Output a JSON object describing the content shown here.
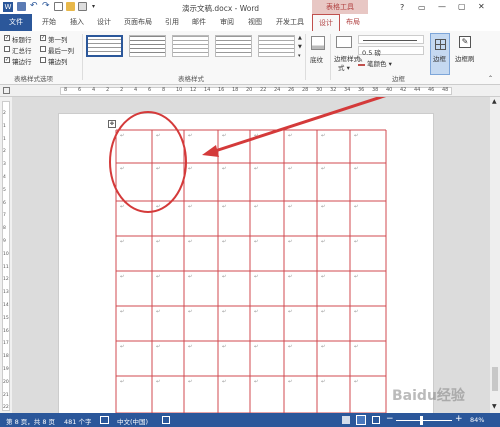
{
  "title": "演示文稿.docx - Word",
  "contextual": {
    "group": "表格工具",
    "design": "设计",
    "layout": "布局"
  },
  "tabs": [
    "开始",
    "插入",
    "设计",
    "页面布局",
    "引用",
    "邮件",
    "审阅",
    "视图",
    "开发工具"
  ],
  "file_tab": "文件",
  "window_buttons": [
    "?",
    "▭",
    "—",
    "▢",
    "✕"
  ],
  "options": {
    "header_row": "标题行",
    "first_col": "第一列",
    "total_row": "汇总行",
    "last_col": "最后一列",
    "banded_rows": "镶边行",
    "banded_cols": "镶边列",
    "group_label": "表格样式选项"
  },
  "styles_group_label": "表格样式",
  "shading": "底纹",
  "border_styles": "边框样式",
  "border_styles_sub": "式 ▾",
  "line_width": "0.5 磅",
  "pen_color": "笔颜色 ▾",
  "borders_btn": "边框",
  "border_painter": "边框刷",
  "borders_group": "边框",
  "ruler_ticks": [
    "8",
    "6",
    "4",
    "2",
    "2",
    "4",
    "6",
    "8",
    "10",
    "12",
    "14",
    "16",
    "18",
    "20",
    "22",
    "24",
    "26",
    "28",
    "30",
    "32",
    "34",
    "36",
    "38",
    "40",
    "42",
    "44",
    "46",
    "48"
  ],
  "vruler_ticks": [
    "2",
    "1",
    "1",
    "2",
    "3",
    "4",
    "5",
    "6",
    "7",
    "8",
    "9",
    "10",
    "11",
    "12",
    "13",
    "14",
    "15",
    "16",
    "17",
    "18",
    "19",
    "20",
    "21",
    "22"
  ],
  "cell_mark": "↵",
  "status": {
    "page": "第 8 页，共 8 页",
    "words": "481 个字",
    "lang": "中文(中国)",
    "zoom": "84%"
  },
  "watermark": "Baidu经验",
  "colors": {
    "accent": "#2b579a",
    "table": "#d0494f",
    "contextual": "#c0504d"
  }
}
